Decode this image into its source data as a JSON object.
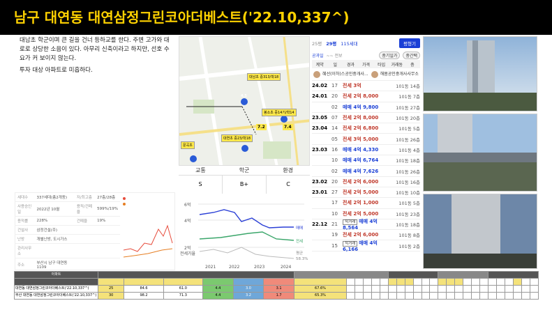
{
  "title": "남구 대연동 대연삼정그린코아더베스트('22.10,337^)",
  "description": {
    "p1": "대남초 학군이며 큰 길을 건너 등하교를 한다. 주변 고가와 대로로 상당한 소음이 있다. 아무리 신축이라고 하지만, 선호 수요가 커 보이지 않는다.",
    "p2": "투자 대상 아파트로 미흡하다."
  },
  "map": {
    "labels": {
      "daenam": "대남초\n중313/학18",
      "bongho": "봉소초\n중14기/학14",
      "daeyeon": "대연초\n중23/학18",
      "mungok": "문곡초",
      "num1": "7.2",
      "num2": "7.4",
      "num3": "4.4",
      "num4": "4.5"
    }
  },
  "grade": {
    "headers": [
      "교통",
      "학군",
      "환경"
    ],
    "values": [
      "S",
      "B+",
      "C"
    ]
  },
  "trade": {
    "year": "25평",
    "units": "29평",
    "households": "115세대",
    "sub_year": "222세대",
    "button": "평형기",
    "filter_left": "공과일",
    "filter_range": "~~ 전보",
    "pill1": "중기일가",
    "pill2": "중간택",
    "cols": [
      "계약",
      "일",
      "경과",
      "가격",
      "타입",
      "거래동",
      "층"
    ],
    "agent1": "혜선(이하)스공인중개사...",
    "agent2": "해봄공인중개사사무소",
    "rows": [
      {
        "date": "24.02",
        "day": "17",
        "tag": "",
        "price": "전세 3억",
        "kind": "jeonse",
        "dong": "101동",
        "floor": "14층"
      },
      {
        "date": "24.01",
        "day": "20",
        "tag": "",
        "price": "전세 2억 8,000",
        "kind": "jeonse",
        "dong": "101동",
        "floor": "7층"
      },
      {
        "date": "",
        "day": "02",
        "tag": "",
        "price": "매매 4억 9,800",
        "kind": "sale",
        "dong": "101동",
        "floor": "27층"
      },
      {
        "date": "23.05",
        "day": "07",
        "tag": "",
        "price": "전세 2억 8,000",
        "kind": "jeonse",
        "dong": "101동",
        "floor": "20층"
      },
      {
        "date": "23.04",
        "day": "14",
        "tag": "",
        "price": "전세 2억 6,800",
        "kind": "jeonse",
        "dong": "101동",
        "floor": "5층"
      },
      {
        "date": "",
        "day": "05",
        "tag": "",
        "price": "전세 3억 5,000",
        "kind": "jeonse",
        "dong": "101동",
        "floor": "26층"
      },
      {
        "date": "23.03",
        "day": "16",
        "tag": "",
        "price": "매매 4억 4,330",
        "kind": "sale",
        "dong": "101동",
        "floor": "4층"
      },
      {
        "date": "",
        "day": "10",
        "tag": "",
        "price": "매매 4억 6,764",
        "kind": "sale",
        "dong": "101동",
        "floor": "18층"
      },
      {
        "date": "",
        "day": "02",
        "tag": "",
        "price": "매매 4억 7,626",
        "kind": "sale",
        "dong": "101동",
        "floor": "26층"
      },
      {
        "date": "23.02",
        "day": "20",
        "tag": "",
        "price": "전세 2억 6,000",
        "kind": "jeonse",
        "dong": "101동",
        "floor": "16층"
      },
      {
        "date": "23.01",
        "day": "27",
        "tag": "",
        "price": "전세 2억 5,000",
        "kind": "jeonse",
        "dong": "101동",
        "floor": "10층"
      },
      {
        "date": "",
        "day": "17",
        "tag": "",
        "price": "전세 2억 1,000",
        "kind": "jeonse",
        "dong": "101동",
        "floor": "5층"
      },
      {
        "date": "",
        "day": "10",
        "tag": "",
        "price": "전세 2억 5,000",
        "kind": "jeonse",
        "dong": "101동",
        "floor": "23층"
      },
      {
        "date": "22.12",
        "day": "21",
        "tag": "직거래",
        "price": "매매 4억 8,564",
        "kind": "sale",
        "dong": "101동",
        "floor": "18층"
      },
      {
        "date": "",
        "day": "19",
        "tag": "",
        "price": "전세 2억 6,000",
        "kind": "jeonse",
        "dong": "101동",
        "floor": "8층"
      },
      {
        "date": "",
        "day": "15",
        "tag": "직거래",
        "price": "매매 4억 6,166",
        "kind": "sale",
        "dong": "101동",
        "floor": "2층"
      }
    ]
  },
  "info": {
    "rows": [
      [
        "세대수",
        "337세대(총2개동)",
        "저/최고층",
        "27층/28층"
      ],
      [
        "사용승인일",
        "2022년 10월",
        "용적/건폐율",
        "599%/19%"
      ],
      [
        "용적률",
        "228%",
        "건폐율",
        "19%"
      ],
      [
        "건설사",
        "삼정건설(주)",
        "",
        ""
      ],
      [
        "난방",
        "개별난방, 도시가스",
        "",
        ""
      ],
      [
        "관리사무소",
        "",
        "",
        ""
      ],
      [
        "주소",
        "부산시 남구 대연동 1109",
        "",
        ""
      ],
      [
        "면적",
        "85㎡, 95㎡",
        "",
        ""
      ]
    ]
  },
  "price_chart": {
    "y_ticks": [
      "6억",
      "4억",
      "2억"
    ],
    "x_ticks": [
      "2021",
      "2022",
      "2023",
      "2024"
    ],
    "ylabel": "전세가율",
    "legend_sale": "매매",
    "legend_jeonse": "전세",
    "legend_ratio": "평균",
    "legend_ratio_val": "58.3%"
  },
  "bottom_table": {
    "group_headers": [
      "아파트",
      "",
      "",
      "",
      "",
      "",
      "평균 단지 매매가(평/억)",
      "",
      "",
      "",
      "",
      "평균 전세가",
      "",
      "",
      "",
      "",
      "매매가 유형별 최고가",
      "",
      "",
      "",
      "",
      "",
      "",
      "",
      "",
      "",
      ""
    ],
    "row1": [
      "대연동 대연삼정그린코아더베스트('22.10,337^)",
      "25",
      "84.6",
      "61.0",
      "4.4",
      "3.0",
      "3.1",
      "67.6%"
    ],
    "row2": [
      "부산 대연동 대연삼정그린코아더베스트('22.10,337^)",
      "30",
      "98.2",
      "71.3",
      "4.4",
      "3.2",
      "1.7",
      "65.3%"
    ]
  }
}
